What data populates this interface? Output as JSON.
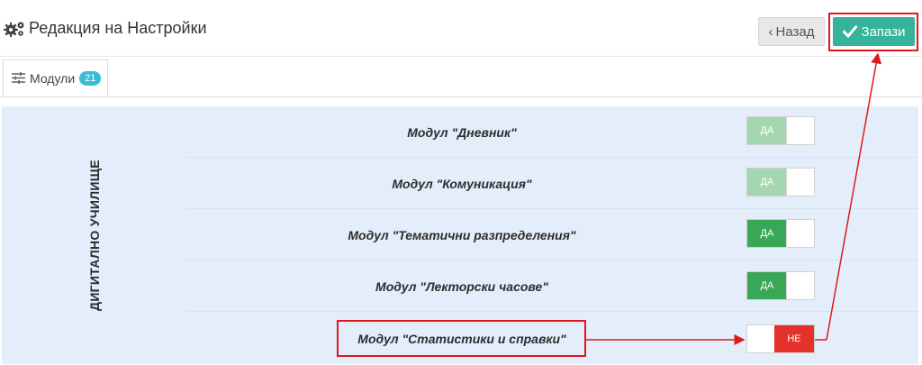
{
  "header": {
    "title": "Редакция на Настройки",
    "back_label": "Назад",
    "save_label": "Запази"
  },
  "tabs": [
    {
      "label": "Модули",
      "badge": "21",
      "icon": "sliders-icon"
    }
  ],
  "group": {
    "label": "ДИГИТАЛНО УЧИЛИЩЕ"
  },
  "modules": [
    {
      "label": "Модул \"Дневник\"",
      "state": "ДА",
      "enabled": true,
      "locked": true
    },
    {
      "label": "Модул \"Комуникация\"",
      "state": "ДА",
      "enabled": true,
      "locked": true
    },
    {
      "label": "Модул \"Тематични разпределения\"",
      "state": "ДА",
      "enabled": true,
      "locked": false
    },
    {
      "label": "Модул \"Лекторски часове\"",
      "state": "ДА",
      "enabled": true,
      "locked": false
    },
    {
      "label": "Модул \"Статистики и справки\"",
      "state": "НЕ",
      "enabled": false,
      "locked": false
    }
  ],
  "colors": {
    "save": "#36b39b",
    "on": "#38a856",
    "on_disabled": "#a5d6b2",
    "off": "#e4312a",
    "badge": "#3bbdd1",
    "panel": "#e4eefb",
    "annotation": "#e0181b"
  }
}
